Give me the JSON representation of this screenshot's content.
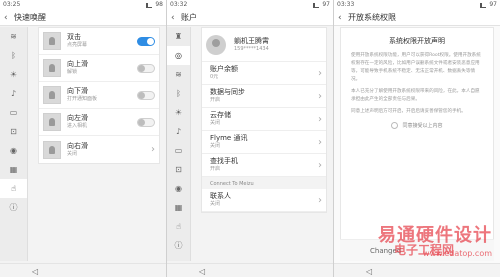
{
  "panel1": {
    "status": {
      "time": "03:25",
      "battery": "98"
    },
    "title": "快速唤醒",
    "rail_icons": [
      "wifi-icon",
      "bluetooth-icon",
      "brightness-icon",
      "sound-icon",
      "battery-icon",
      "lock-icon",
      "location-icon",
      "apps-icon",
      "gesture-icon",
      "info-icon"
    ],
    "items": [
      {
        "title": "双击",
        "sub": "点亮屏幕",
        "control": "toggle-on"
      },
      {
        "title": "向上滑",
        "sub": "解锁",
        "control": "toggle-off"
      },
      {
        "title": "向下滑",
        "sub": "打开通知面板",
        "control": "toggle-off"
      },
      {
        "title": "向左滑",
        "sub": "进入相机",
        "control": "toggle-off"
      },
      {
        "title": "向右滑",
        "sub": "关闭",
        "control": "chevron"
      }
    ]
  },
  "panel2": {
    "status": {
      "time": "03:32",
      "battery": "97"
    },
    "title": "账户",
    "account": {
      "name": "躺机王腾霄",
      "id": "159*****1434"
    },
    "items": [
      {
        "title": "账户余额",
        "sub": "0元"
      },
      {
        "title": "数据与同步",
        "sub": "开启"
      },
      {
        "title": "云存储",
        "sub": "关闭"
      },
      {
        "title": "Flyme 通讯",
        "sub": "关闭"
      },
      {
        "title": "查找手机",
        "sub": "开启"
      }
    ],
    "section": "Connect To Meizu",
    "items2": [
      {
        "title": "联系人",
        "sub": "关闭"
      }
    ]
  },
  "panel3": {
    "status": {
      "time": "03:33",
      "battery": "97"
    },
    "title": "开放系统权限",
    "doc_title": "系统权限开放声明",
    "paragraphs": [
      "使用开放系统权限功能，用户可以获得Root权限。使用开放系统权限存在一定的风险，比如用户误删系统文件或者安装恶意应用等，可能导致手机系统不稳定、无法正常开机、数据丢失等情况。",
      "本人已充分了解使用开放系统权限带来的风险，在此，本人自愿承担由此产生的全部责任与后果。",
      "同意上述声明后方可开启，开启后请妥善保管您的手机。"
    ],
    "agree_label": "同意接受以上内容",
    "bottom_label": "Changed"
  },
  "watermark": {
    "line1": "易通硬件设计",
    "line2": "电子工程网",
    "url": "www.edatop.com"
  }
}
